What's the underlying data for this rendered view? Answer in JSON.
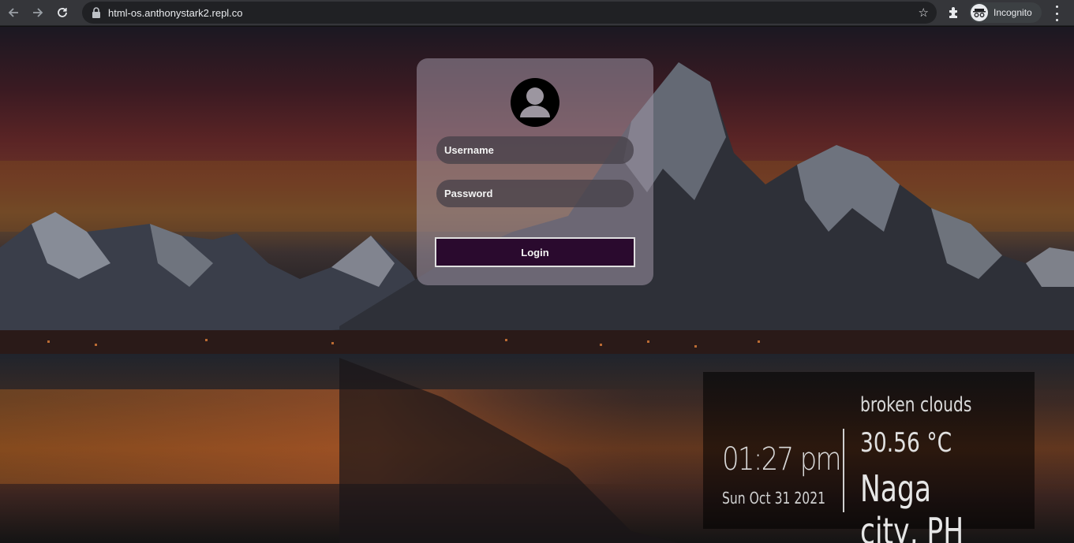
{
  "browser": {
    "url": "html-os.anthonystark2.repl.co",
    "incognito_label": "Incognito",
    "icons": [
      "back-icon",
      "forward-icon",
      "reload-icon",
      "lock-icon",
      "star-icon",
      "extensions-icon",
      "incognito-icon",
      "more-menu-icon"
    ]
  },
  "login": {
    "username_placeholder": "Username",
    "password_placeholder": "Password",
    "login_label": "Login",
    "avatar_icon": "user-avatar-icon"
  },
  "widget": {
    "time": "01:27 pm",
    "date": "Sun Oct 31 2021",
    "weather": "broken clouds",
    "temperature": "30.56 °C",
    "city": "Naga city, PH"
  },
  "colors": {
    "chrome_bg": "#35363a",
    "omnibox_bg": "#202124",
    "login_button_bg": "#2a0a2e",
    "card_bg": "rgba(160,150,165,0.55)"
  }
}
